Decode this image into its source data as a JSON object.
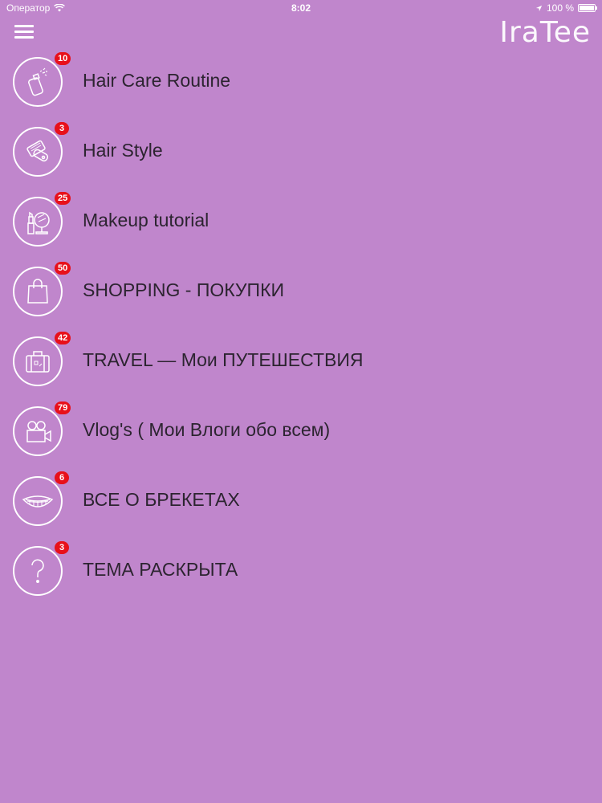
{
  "status_bar": {
    "carrier": "Оператор",
    "time": "8:02",
    "battery": "100 %"
  },
  "header": {
    "logo": "IraTee"
  },
  "menu": [
    {
      "label": "Hair Care Routine",
      "badge": "10",
      "icon": "hair-spray-icon"
    },
    {
      "label": "Hair Style",
      "badge": "3",
      "icon": "hair-straightener-icon"
    },
    {
      "label": "Makeup tutorial",
      "badge": "25",
      "icon": "makeup-mirror-icon"
    },
    {
      "label": "SHOPPING - ПОКУПКИ",
      "badge": "50",
      "icon": "shopping-bag-icon"
    },
    {
      "label": "TRAVEL — Мои ПУТЕШЕСТВИЯ",
      "badge": "42",
      "icon": "suitcase-icon"
    },
    {
      "label": "Vlog's ( Мои Влоги обо всем)",
      "badge": "79",
      "icon": "video-camera-icon"
    },
    {
      "label": "ВСЕ О БРЕКЕТАХ",
      "badge": "6",
      "icon": "braces-smile-icon"
    },
    {
      "label": "ТЕМА РАСКРЫТА",
      "badge": "3",
      "icon": "question-mark-icon"
    }
  ],
  "colors": {
    "background": "#c086cc",
    "badge": "#e8101a",
    "icon_stroke": "#ffffff",
    "text": "#2c2430"
  }
}
